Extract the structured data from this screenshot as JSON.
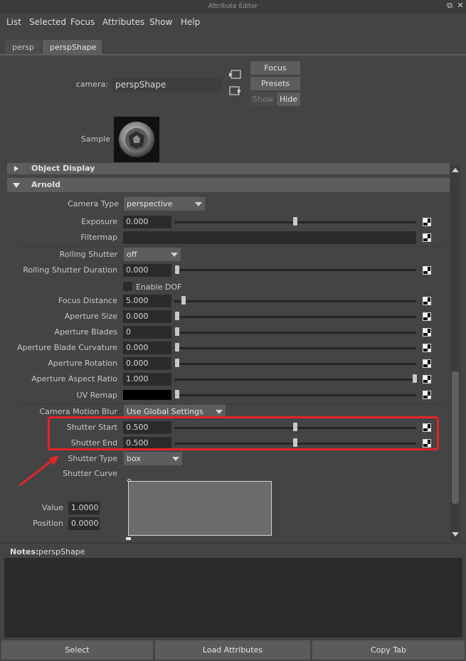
{
  "window": {
    "title": "Attribute Editor"
  },
  "menu": [
    "List",
    "Selected",
    "Focus",
    "Attributes",
    "Show",
    "Help"
  ],
  "tabs": [
    {
      "label": "persp",
      "active": false
    },
    {
      "label": "perspShape",
      "active": true
    }
  ],
  "header": {
    "camera_label": "camera:",
    "camera_value": "perspShape",
    "focus_label": "Focus",
    "presets_label": "Presets",
    "show_label": "Show",
    "hide_label": "Hide",
    "sample_label": "Sample"
  },
  "sections": {
    "object_display": "Object Display",
    "arnold": "Arnold"
  },
  "arnold": {
    "camera_type": {
      "label": "Camera Type",
      "value": "perspective"
    },
    "exposure": {
      "label": "Exposure",
      "value": "0.000",
      "slider": 0.5
    },
    "filtermap": {
      "label": "Filtermap"
    },
    "rolling_shutter": {
      "label": "Rolling Shutter",
      "value": "off"
    },
    "rolling_shutter_duration": {
      "label": "Rolling Shutter Duration",
      "value": "0.000",
      "slider": 0.0
    },
    "enable_dof": {
      "label": "Enable DOF",
      "checked": false
    },
    "focus_distance": {
      "label": "Focus Distance",
      "value": "5.000",
      "slider": 0.03
    },
    "aperture_size": {
      "label": "Aperture Size",
      "value": "0.000",
      "slider": 0.0
    },
    "aperture_blades": {
      "label": "Aperture Blades",
      "value": "0",
      "slider": 0.0
    },
    "aperture_blade_curvature": {
      "label": "Aperture Blade Curvature",
      "value": "0.000",
      "slider": 0.0
    },
    "aperture_rotation": {
      "label": "Aperture Rotation",
      "value": "0.000",
      "slider": 0.0
    },
    "aperture_aspect_ratio": {
      "label": "Aperture Aspect Ratio",
      "value": "1.000",
      "slider": 1.0
    },
    "uv_remap": {
      "label": "UV Remap",
      "slider": 0.0
    },
    "camera_motion_blur": {
      "label": "Camera Motion Blur",
      "value": "Use Global Settings"
    },
    "shutter_start": {
      "label": "Shutter Start",
      "value": "0.500",
      "slider": 0.5
    },
    "shutter_end": {
      "label": "Shutter End",
      "value": "0.500",
      "slider": 0.5
    },
    "shutter_type": {
      "label": "Shutter Type",
      "value": "box"
    },
    "shutter_curve": {
      "label": "Shutter Curve"
    },
    "curve_value": {
      "label": "Value",
      "value": "1.0000"
    },
    "curve_position": {
      "label": "Position",
      "value": "0.0000"
    }
  },
  "notes": {
    "label": "Notes:",
    "value": "perspShape"
  },
  "bottom": {
    "select": "Select",
    "load_attributes": "Load Attributes",
    "copy_tab": "Copy Tab"
  },
  "colors": {
    "highlight": "#e0262a",
    "panel": "#444444",
    "field": "#2b2b2b",
    "button": "#5d5d5d"
  }
}
